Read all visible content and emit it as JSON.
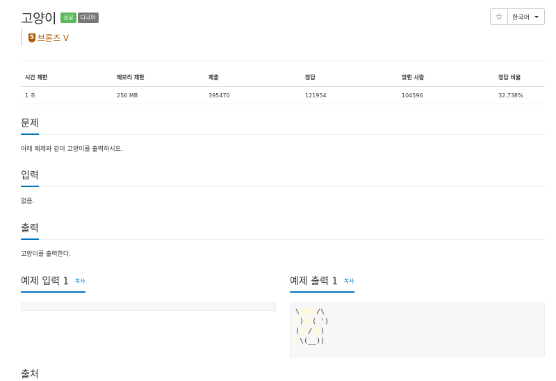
{
  "problem": {
    "title": "고양이",
    "badges": {
      "success": "성공",
      "multilang": "다국어"
    },
    "tier": {
      "level": "5",
      "label": "브론즈 V"
    }
  },
  "toolbar": {
    "star_icon": "star-icon",
    "star_glyph": "☆",
    "language": "한국어"
  },
  "info": {
    "headers": [
      "시간 제한",
      "메모리 제한",
      "제출",
      "정답",
      "맞힌 사람",
      "정답 비율"
    ],
    "values": [
      "1 초",
      "256 MB",
      "395470",
      "121954",
      "104596",
      "32.738%"
    ]
  },
  "sections": {
    "description": {
      "title": "문제",
      "body": "아래 예제와 같이 고양이를 출력하시오."
    },
    "input": {
      "title": "입력",
      "body": "없음."
    },
    "output": {
      "title": "출력",
      "body": "고양이를 출력한다."
    }
  },
  "samples": {
    "input": {
      "title": "예제 입력 1",
      "copy": "복사"
    },
    "output": {
      "title": "예제 출력 1",
      "copy": "복사",
      "lines": [
        [
          "\\",
          "    ",
          "/\\"
        ],
        [
          " ",
          ")",
          "  ",
          "( ",
          "')"
        ],
        [
          "(",
          "  ",
          "/",
          "  ",
          ")"
        ],
        [
          " ",
          "\\(__)|"
        ]
      ]
    }
  },
  "next_section": {
    "title": "출처"
  },
  "colors": {
    "accent": "#0076c0",
    "success": "#5cb85c",
    "bronze": "#ad5600",
    "highlight": "#fcf8e3"
  }
}
